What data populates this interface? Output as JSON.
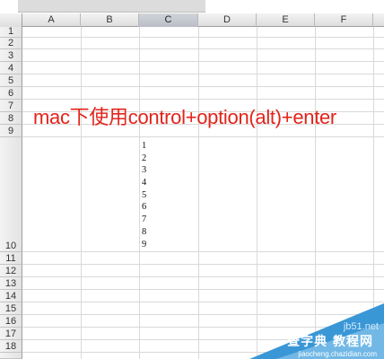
{
  "spreadsheet": {
    "columns": [
      "A",
      "B",
      "C",
      "D",
      "E",
      "F"
    ],
    "selected_column": "C",
    "rows": [
      "1",
      "2",
      "3",
      "4",
      "5",
      "6",
      "7",
      "8",
      "9",
      "10",
      "11",
      "12",
      "13",
      "14",
      "15",
      "16",
      "17",
      "18"
    ]
  },
  "annotation": {
    "text": "mac下使用control+option(alt)+enter",
    "color": "#e2231a"
  },
  "cell_c10": {
    "lines": [
      "1",
      "2",
      "3",
      "4",
      "5",
      "6",
      "7",
      "8",
      "9"
    ]
  },
  "watermark": {
    "site": "jb51.net",
    "name": "查字典 教程网",
    "url": "jiaocheng.chazidian.com",
    "color": "#3a97d6"
  }
}
